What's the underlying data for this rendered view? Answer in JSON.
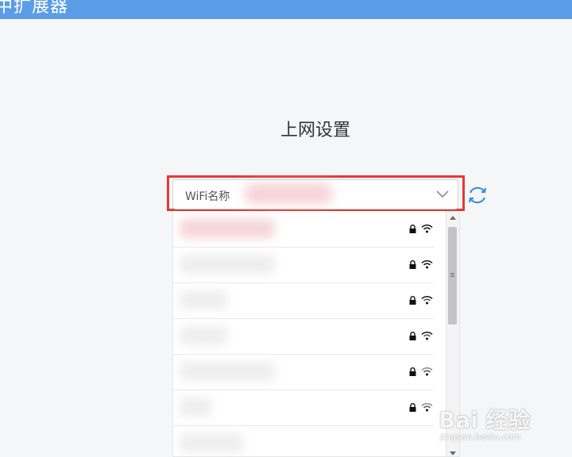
{
  "header": {
    "title": "中扩展器"
  },
  "page": {
    "title": "上网设置"
  },
  "wifi_select": {
    "label": "WiFi名称",
    "value_redacted": true,
    "icons": [
      "chevron-down-icon"
    ]
  },
  "refresh": {
    "icon": "refresh-icon",
    "color": "#3a8ee6"
  },
  "network_list": {
    "items": [
      {
        "ssid_redacted": true,
        "secured": true,
        "icons": [
          "lock-icon",
          "wifi-icon"
        ]
      },
      {
        "ssid_redacted": true,
        "secured": true,
        "icons": [
          "lock-icon",
          "wifi-icon"
        ]
      },
      {
        "ssid_redacted": true,
        "secured": true,
        "icons": [
          "lock-icon",
          "wifi-icon"
        ]
      },
      {
        "ssid_redacted": true,
        "secured": true,
        "icons": [
          "lock-icon",
          "wifi-icon"
        ]
      },
      {
        "ssid_redacted": true,
        "secured": true,
        "icons": [
          "lock-icon",
          "wifi-icon"
        ]
      },
      {
        "ssid_redacted": true,
        "secured": true,
        "icons": [
          "lock-icon",
          "wifi-icon"
        ]
      }
    ]
  },
  "watermark": {
    "brand": "Bai 经验",
    "url": "jingyan.baidu.com"
  },
  "colors": {
    "header": "#5b9de6",
    "highlight": "#e53935",
    "background": "#f5f6f7"
  }
}
